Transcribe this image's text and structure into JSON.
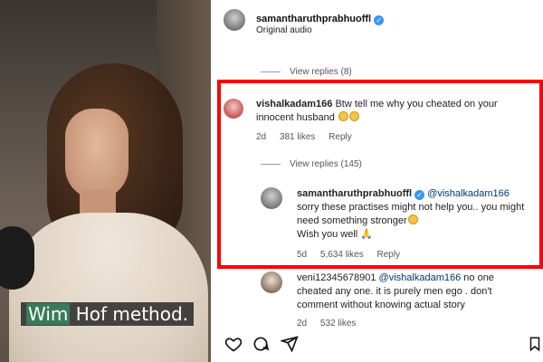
{
  "video": {
    "caption_highlight": "Wim",
    "caption_rest": " Hof method."
  },
  "header": {
    "username": "samantharuthprabhuoffl",
    "subtitle": "Original audio"
  },
  "thread1": {
    "view_replies": "View replies (8)"
  },
  "comment_vishal": {
    "username": "vishalkadam166",
    "text": "Btw tell me why you cheated on your innocent husband",
    "time": "2d",
    "likes": "381 likes",
    "reply": "Reply",
    "view_replies": "View replies (145)"
  },
  "reply_sam": {
    "username": "samantharuthprabhuoffl",
    "mention": "@vishalkadam166",
    "text": "sorry these practises might not help you.. you might need something stronger",
    "text2": "Wish you well",
    "time": "5d",
    "likes": "5,634 likes",
    "reply": "Reply"
  },
  "comment_veni": {
    "username": "veni12345678901",
    "mention": "@vishalkadam166",
    "text": "no one cheated any one. it is purely men ego . don't comment without knowing actual story",
    "time": "2d",
    "likes": "532 likes"
  },
  "icons": [
    "heart-icon",
    "comment-icon",
    "share-icon",
    "bookmark-icon"
  ],
  "colors": {
    "highlight_box": "#ff0000",
    "verified": "#3897f0",
    "mention": "#00376b"
  }
}
